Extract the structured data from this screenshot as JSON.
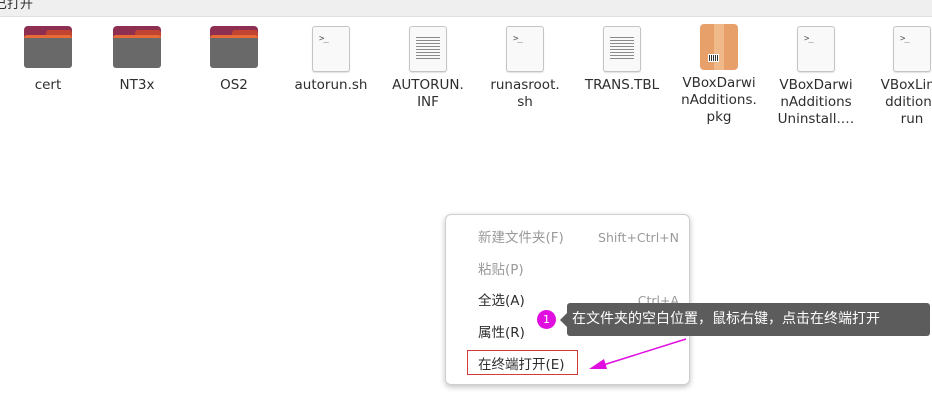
{
  "topbar": {
    "title": "已打开"
  },
  "files": [
    {
      "name": "cert",
      "type": "folder"
    },
    {
      "name": "NT3x",
      "type": "folder"
    },
    {
      "name": "OS2",
      "type": "folder"
    },
    {
      "name": "autorun.sh",
      "type": "script"
    },
    {
      "name": "AUTORUN.\nINF",
      "type": "text"
    },
    {
      "name": "runasroot.\nsh",
      "type": "script"
    },
    {
      "name": "TRANS.TBL",
      "type": "text"
    },
    {
      "name": "VBoxDarwi\nnAdditions.\npkg",
      "type": "package"
    },
    {
      "name": "VBoxDarwi\nnAdditions\nUninstall.…",
      "type": "script"
    },
    {
      "name": "VBoxLinu\ndditions\nrun",
      "type": "script"
    }
  ],
  "context_menu": {
    "items": [
      {
        "label": "新建文件夹(F)",
        "shortcut": "Shift+Ctrl+N",
        "enabled": false
      },
      {
        "label": "粘贴(P)",
        "shortcut": "",
        "enabled": false
      },
      {
        "label": "全选(A)",
        "shortcut": "Ctrl+A",
        "enabled": true
      },
      {
        "label": "属性(R)",
        "shortcut": "",
        "enabled": true
      },
      {
        "label": "在终端打开(E)",
        "shortcut": "",
        "enabled": true
      }
    ]
  },
  "annotation": {
    "step": "1",
    "text": "在文件夹的空白位置，鼠标右键，点击在终端打开"
  },
  "colors": {
    "callout_bg": "#5c5c5c",
    "badge": "#e10ee0",
    "highlight_border": "#d23b3b",
    "arrow": "#e10ee0"
  }
}
